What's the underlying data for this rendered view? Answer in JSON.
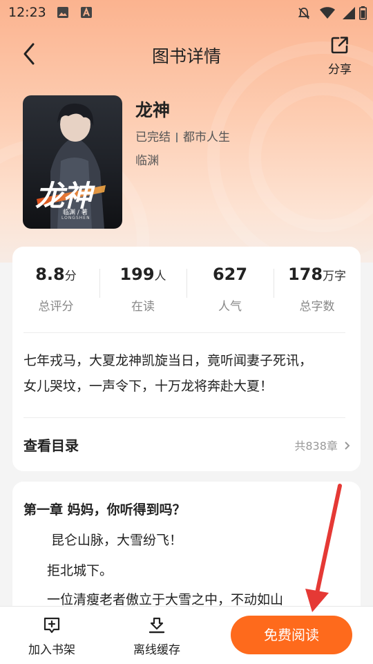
{
  "status_bar": {
    "time": "12:23"
  },
  "nav": {
    "title": "图书详情",
    "share_label": "分享"
  },
  "book": {
    "title": "龙神",
    "status": "已完结",
    "category": "都市人生",
    "author": "临渊",
    "cover_title": "龙神",
    "cover_author": "临渊 / 著",
    "cover_pinyin": "LONGSHEN"
  },
  "stats": [
    {
      "value": "8.8",
      "unit": "分",
      "label": "总评分"
    },
    {
      "value": "199",
      "unit": "人",
      "label": "在读"
    },
    {
      "value": "627",
      "unit": "",
      "label": "人气"
    },
    {
      "value": "178",
      "unit": "万字",
      "label": "总字数"
    }
  ],
  "description": {
    "line1": "七年戎马，大夏龙神凯旋当日，竟听闻妻子死讯，",
    "line2": "女儿哭坟，一声令下，十万龙将奔赴大夏！"
  },
  "toc": {
    "label": "查看目录",
    "chapters": "共838章"
  },
  "preview": {
    "chapter_title": "第一章 妈妈，你听得到吗？",
    "paragraphs": [
      "昆仑山脉，大雪纷飞！",
      "拒北城下。",
      "一位清瘦老者傲立于大雪之中，不动如山"
    ]
  },
  "bottom_bar": {
    "add_shelf": "加入书架",
    "offline": "离线缓存",
    "read": "免费阅读"
  },
  "colors": {
    "accent": "#fe6a1c",
    "hero": "#fbb38f",
    "arrow": "#e53935"
  }
}
